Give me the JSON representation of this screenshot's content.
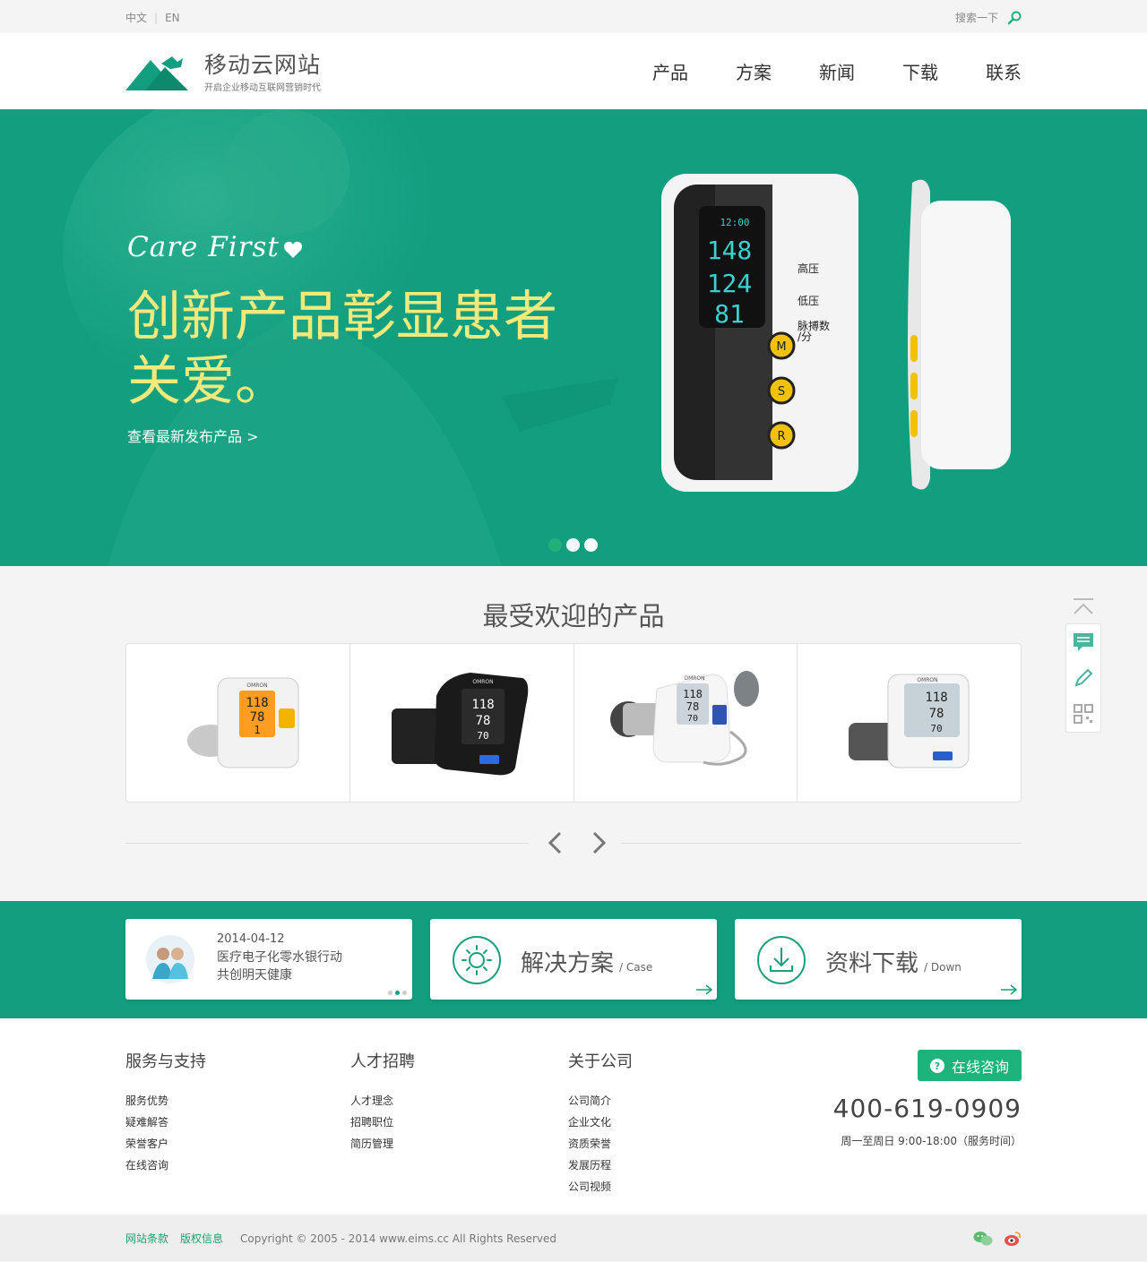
{
  "topbar": {
    "lang_cn": "中文",
    "lang_en": "EN",
    "search_label": "搜索一下",
    "search_icon": "search-icon"
  },
  "header": {
    "logo_title": "移动云网站",
    "logo_subtitle": "开启企业移动互联网营销时代",
    "nav": [
      "产品",
      "方案",
      "新闻",
      "下载",
      "联系"
    ]
  },
  "hero": {
    "script_title": "Care First",
    "headline_line1": "创新产品彰显患者",
    "headline_line2": "关爱。",
    "link": "查看最新发布产品 >",
    "slides": 3,
    "active_slide": 1,
    "device": {
      "time": "12:00",
      "systolic": "148",
      "diastolic": "124",
      "pulse": "81",
      "label_high": "高压",
      "label_low": "低压",
      "label_pulse": "脉搏数",
      "label_pulse_unit": "/分",
      "buttons": [
        "M",
        "S",
        "R"
      ]
    }
  },
  "products": {
    "title": "最受欢迎的产品",
    "items": [
      {
        "name": "blood-pressure-monitor-1",
        "readings": [
          "118",
          "78",
          "1"
        ],
        "brand": "OMRON",
        "badge": "开始 停止"
      },
      {
        "name": "blood-pressure-monitor-2",
        "readings": [
          "118",
          "78",
          "70"
        ],
        "brand": "OMRON"
      },
      {
        "name": "blood-pressure-monitor-3",
        "readings": [
          "118",
          "78",
          "70"
        ],
        "brand": "OMRON"
      },
      {
        "name": "blood-pressure-monitor-4",
        "readings": [
          "118",
          "78",
          "70"
        ],
        "brand": "OMRON"
      }
    ]
  },
  "cards": {
    "news_date": "2014-04-12",
    "news_line1": "医疗电子化零水银行动",
    "news_line2": "共创明天健康",
    "solution_title": "解决方案",
    "solution_sub": "/ Case",
    "download_title": "资料下载",
    "download_sub": "/ Down"
  },
  "footer": {
    "col1": {
      "title": "服务与支持",
      "links": [
        "服务优势",
        "疑难解答",
        "荣誉客户",
        "在线咨询"
      ]
    },
    "col2": {
      "title": "人才招聘",
      "links": [
        "人才理念",
        "招聘职位",
        "简历管理"
      ]
    },
    "col3": {
      "title": "关于公司",
      "links": [
        "公司简介",
        "企业文化",
        "资质荣誉",
        "发展历程",
        "公司视频"
      ]
    },
    "consult_label": "在线咨询",
    "phone": "400-619-0909",
    "hours": "周一至周日 9:00-18:00（服务时间）"
  },
  "bottom": {
    "terms": "网站条款",
    "copyright_info": "版权信息",
    "copyright": "Copyright © 2005 - 2014 www.eims.cc All Rights Reserved"
  },
  "colors": {
    "brand_green": "#119f80",
    "headline_yellow": "#f3e97a",
    "button_green": "#1db37c"
  }
}
